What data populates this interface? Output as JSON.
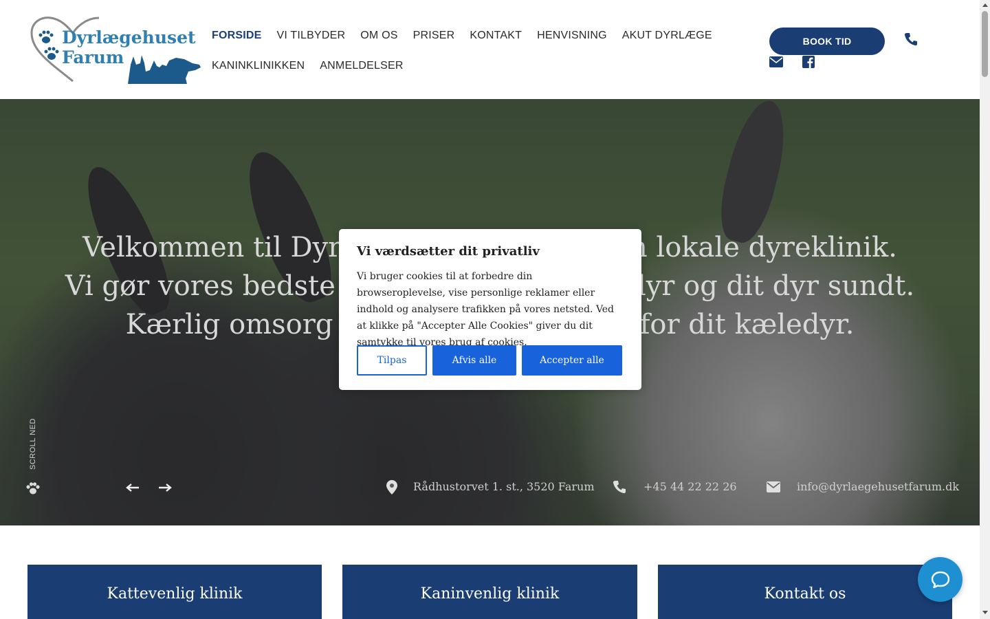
{
  "brand": {
    "line1": "Dyrlægehuset",
    "line2": "Farum",
    "color": "#2f7fb0"
  },
  "nav": {
    "row1": [
      "FORSIDE",
      "VI TILBYDER",
      "OM OS",
      "PRISER",
      "KONTAKT",
      "HENVISNING",
      "AKUT DYRLÆGE"
    ],
    "row2": [
      "KANINKLINIKKEN",
      "ANMELDELSER"
    ],
    "active": "FORSIDE"
  },
  "header": {
    "book_label": "BOOK TID",
    "icons": [
      "phone-icon",
      "envelope-icon",
      "facebook-icon"
    ],
    "accent": "#1a3d73"
  },
  "hero": {
    "line1": "Velkommen til Dyrlægehuset Farum, din lokale dyreklinik.",
    "line2": "Vi gør vores bedste for at holde dit kæledyr og dit dyr sundt.",
    "line3": "Kærlig omsorg og professionel pleje for dit kæledyr.",
    "scroll_label": "SCROLL NED",
    "address": "Rådhustorvet 1. st., 3520 Farum",
    "phone": "+45 44 22 22 26",
    "email": "info@dyrlaegehusetfarum.dk"
  },
  "cookie": {
    "title": "Vi værdsætter dit privatliv",
    "body": "Vi bruger cookies til at forbedre din browseroplevelse, vise personlige reklamer eller indhold og analysere trafikken på vores netsted. Ved at klikke på \"Accepter Alle Cookies\" giver du dit samtykke til vores brug af cookies.",
    "customize": "Tilpas",
    "reject": "Afvis alle",
    "accept": "Accepter alle",
    "button_color": "#1863dc"
  },
  "cards": [
    "Kattevenlig klinik",
    "Kaninvenlig klinik",
    "Kontakt os"
  ]
}
